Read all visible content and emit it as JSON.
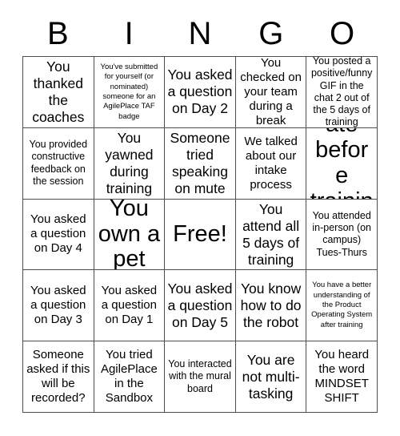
{
  "card": {
    "header_letters": [
      "B",
      "I",
      "N",
      "G",
      "O"
    ],
    "rows": [
      [
        {
          "text": "You thanked the coaches",
          "size": "lg"
        },
        {
          "text": "You've submitted for yourself (or nominated) someone for an AgilePlace TAF badge",
          "size": "xs"
        },
        {
          "text": "You asked a question on Day 2",
          "size": "lg"
        },
        {
          "text": "You checked on your team during a break",
          "size": "md"
        },
        {
          "text": "You posted a positive/funny GIF in the chat 2 out of the 5 days of training",
          "size": "sm"
        }
      ],
      [
        {
          "text": "You provided constructive feedback on the session",
          "size": "sm"
        },
        {
          "text": "You yawned during training",
          "size": "lg"
        },
        {
          "text": "Someone tried speaking on mute",
          "size": "lg"
        },
        {
          "text": "We talked about our intake process",
          "size": "md"
        },
        {
          "text": "You ate before training",
          "size": "xl"
        }
      ],
      [
        {
          "text": "You asked a question on Day 4",
          "size": "md"
        },
        {
          "text": "You own a pet",
          "size": "xl"
        },
        {
          "text": "Free!",
          "size": "xl"
        },
        {
          "text": "You attend all 5 days of training",
          "size": "lg"
        },
        {
          "text": "You attended in-person (on campus) Tues-Thurs",
          "size": "sm"
        }
      ],
      [
        {
          "text": "You asked a question on Day 3",
          "size": "md"
        },
        {
          "text": "You asked a question on Day 1",
          "size": "md"
        },
        {
          "text": "You asked a question on Day 5",
          "size": "lg"
        },
        {
          "text": "You know how to do the robot",
          "size": "lg"
        },
        {
          "text": "You have a better understanding of the Product Operating System after training",
          "size": "xs"
        }
      ],
      [
        {
          "text": "Someone asked if this will be recorded?",
          "size": "md"
        },
        {
          "text": "You tried AgilePlace in the Sandbox",
          "size": "md"
        },
        {
          "text": "You interacted with the mural board",
          "size": "sm"
        },
        {
          "text": "You are not multi-tasking",
          "size": "lg"
        },
        {
          "text": "You heard the word MINDSET SHIFT",
          "size": "md"
        }
      ]
    ]
  },
  "colors": {
    "text": "#000000",
    "grid_line": "#4d4d4d",
    "background": "#ffffff"
  }
}
